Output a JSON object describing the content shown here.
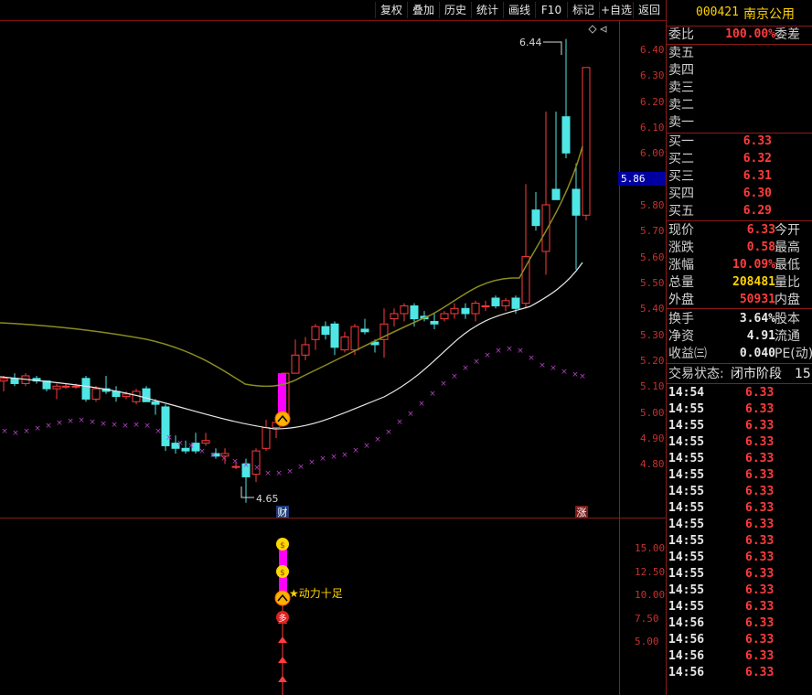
{
  "toolbar": {
    "buttons": [
      "复权",
      "叠加",
      "历史",
      "统计",
      "画线",
      "F10",
      "标记",
      "+自选",
      "返回"
    ]
  },
  "stock": {
    "code": "000421",
    "name": "南京公用"
  },
  "order_book": {
    "weibi_label": "委比",
    "weibi_value": "100.00%",
    "weicha_label": "委差",
    "sell": [
      {
        "label": "卖五"
      },
      {
        "label": "卖四"
      },
      {
        "label": "卖三"
      },
      {
        "label": "卖二"
      },
      {
        "label": "卖一"
      }
    ],
    "buy": [
      {
        "label": "买一",
        "price": "6.33"
      },
      {
        "label": "买二",
        "price": "6.32"
      },
      {
        "label": "买三",
        "price": "6.31"
      },
      {
        "label": "买四",
        "price": "6.30"
      },
      {
        "label": "买五",
        "price": "6.29"
      }
    ]
  },
  "quote": [
    {
      "label": "现价",
      "value": "6.33",
      "label2": "今开",
      "color": "red"
    },
    {
      "label": "涨跌",
      "value": "0.58",
      "label2": "最高",
      "color": "red"
    },
    {
      "label": "涨幅",
      "value": "10.09%",
      "label2": "最低",
      "color": "red"
    },
    {
      "label": "总量",
      "value": "208481",
      "label2": "量比",
      "color": "yellow"
    },
    {
      "label": "外盘",
      "value": "50931",
      "label2": "内盘",
      "color": "red"
    }
  ],
  "fundamentals": [
    {
      "label": "换手",
      "value": "3.64%",
      "label2": "股本"
    },
    {
      "label": "净资",
      "value": "4.91",
      "label2": "流通"
    },
    {
      "label": "收益㈢",
      "value": "0.040",
      "label2": "PE(动)"
    }
  ],
  "trade_status": {
    "label": "交易状态:",
    "value": "闭市阶段",
    "extra": "15"
  },
  "ticks": [
    {
      "time": "14:54",
      "price": "6.33"
    },
    {
      "time": "14:55",
      "price": "6.33"
    },
    {
      "time": "14:55",
      "price": "6.33"
    },
    {
      "time": "14:55",
      "price": "6.33"
    },
    {
      "time": "14:55",
      "price": "6.33"
    },
    {
      "time": "14:55",
      "price": "6.33"
    },
    {
      "time": "14:55",
      "price": "6.33"
    },
    {
      "time": "14:55",
      "price": "6.33"
    },
    {
      "time": "14:55",
      "price": "6.33"
    },
    {
      "time": "14:55",
      "price": "6.33"
    },
    {
      "time": "14:55",
      "price": "6.33"
    },
    {
      "time": "14:55",
      "price": "6.33"
    },
    {
      "time": "14:55",
      "price": "6.33"
    },
    {
      "time": "14:55",
      "price": "6.33"
    },
    {
      "time": "14:56",
      "price": "6.33"
    },
    {
      "time": "14:56",
      "price": "6.33"
    },
    {
      "time": "14:56",
      "price": "6.33"
    },
    {
      "time": "14:56",
      "price": "6.33"
    }
  ],
  "main_chart": {
    "y_ticks": [
      "6.40",
      "6.30",
      "6.20",
      "6.10",
      "6.00",
      "5.90",
      "5.80",
      "5.70",
      "5.60",
      "5.50",
      "5.40",
      "5.30",
      "5.20",
      "5.10",
      "5.00",
      "4.90",
      "4.80"
    ],
    "current_price_tag": "5.86",
    "high_label": "6.44",
    "low_label": "4.65",
    "marker_cai": "财",
    "marker_zhang": "涨"
  },
  "sub_chart": {
    "y_ticks": [
      "15.00",
      "12.50",
      "10.00",
      "7.50",
      "5.00"
    ],
    "annotation": "★动力十足",
    "marker_duo": "多"
  },
  "colors": {
    "up": "#ff3c3c",
    "down": "#4fe6e6",
    "ma_olive": "#8b8b20",
    "ma_white": "#e8e8e8",
    "dots": "#b040c0",
    "magenta": "#ff00ff",
    "grid": "#8b1a1a"
  }
}
